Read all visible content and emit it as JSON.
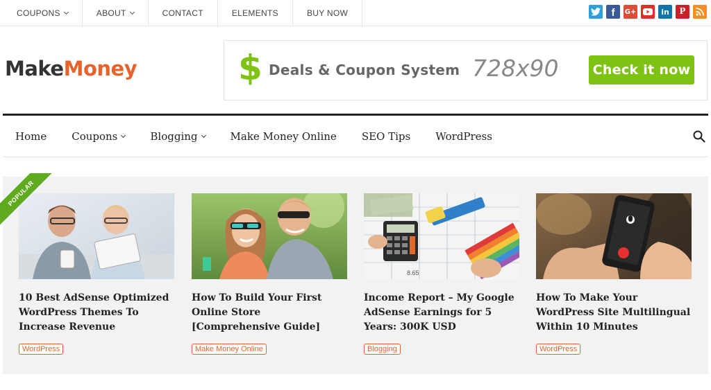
{
  "topnav": {
    "items": [
      "COUPONS",
      "ABOUT",
      "CONTACT",
      "ELEMENTS",
      "BUY NOW"
    ]
  },
  "social": {
    "icons": [
      {
        "name": "twitter-icon",
        "glyph": "t",
        "color": "#2d9fd9"
      },
      {
        "name": "facebook-icon",
        "glyph": "f",
        "color": "#3b5998"
      },
      {
        "name": "google-plus-icon",
        "glyph": "G+",
        "color": "#dd4b39"
      },
      {
        "name": "youtube-icon",
        "glyph": "▶",
        "color": "#e52d27"
      },
      {
        "name": "linkedin-icon",
        "glyph": "in",
        "color": "#0e76a8"
      },
      {
        "name": "pinterest-icon",
        "glyph": "P",
        "color": "#cb2027"
      },
      {
        "name": "rss-icon",
        "glyph": "◉",
        "color": "#f58e20"
      }
    ]
  },
  "logo": {
    "part1": "Make",
    "part2": "Money"
  },
  "banner": {
    "dollar": "$",
    "text": "Deals & Coupon System",
    "size": "728x90",
    "button": "Check it now"
  },
  "mainnav": {
    "items": [
      "Home",
      "Coupons",
      "Blogging",
      "Make Money Online",
      "SEO Tips",
      "WordPress"
    ]
  },
  "featured": {
    "ribbon": "POPULAR",
    "cards": [
      {
        "title": "10 Best AdSense Optimized WordPress Themes To Increase Revenue",
        "tag": "WordPress"
      },
      {
        "title": "How To Build Your First Online Store [Comprehensive Guide]",
        "tag": "Make Money Online"
      },
      {
        "title": "Income Report – My Google AdSense Earnings for 5 Years: 300K USD",
        "tag": "Blogging"
      },
      {
        "title": "How To Make Your WordPress Site Multilingual Within 10 Minutes",
        "tag": "WordPress"
      }
    ]
  }
}
